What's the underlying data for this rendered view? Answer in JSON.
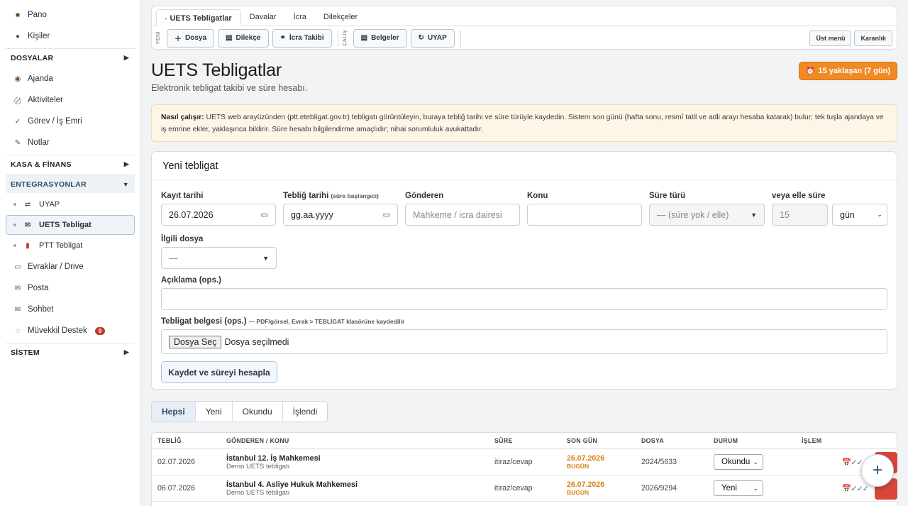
{
  "sidebar": {
    "top_items": [
      {
        "label": "Pano",
        "icon": "dashboard-icon"
      },
      {
        "label": "Kişiler",
        "icon": "people-icon"
      }
    ],
    "sections": [
      {
        "label": "DOSYALAR",
        "open": false
      },
      {
        "label": "KASA & FİNANS",
        "open": false
      },
      {
        "label": "ENTEGRASYONLAR",
        "open": true
      },
      {
        "label": "SİSTEM",
        "open": false
      }
    ],
    "dosyalar_items": [
      {
        "label": "Ajanda",
        "icon": "calendar-icon"
      },
      {
        "label": "Aktiviteler",
        "icon": "activity-icon"
      },
      {
        "label": "Görev / İş Emri",
        "icon": "check-icon"
      },
      {
        "label": "Notlar",
        "icon": "pencil-icon"
      }
    ],
    "integration_items": [
      {
        "label": "UYAP",
        "icon": "swap-icon"
      },
      {
        "label": "UETS Tebligat",
        "icon": "mail-icon",
        "active": true
      },
      {
        "label": "PTT Tebligat",
        "icon": "stamp-icon"
      },
      {
        "label": "Evraklar / Drive",
        "icon": "folder-icon"
      },
      {
        "label": "Posta",
        "icon": "envelope-icon"
      },
      {
        "label": "Sohbet",
        "icon": "chat-icon"
      },
      {
        "label": "Müvekkil Destek",
        "icon": "support-icon",
        "badge": "9"
      }
    ],
    "arrow_right": "▶",
    "arrow_down": "▼"
  },
  "topbar": {
    "tabs": [
      "UETS Tebligatlar",
      "Davalar",
      "İcra",
      "Dilekçeler"
    ],
    "yeni_label": "YENİ",
    "calis_label": "ÇALIŞ",
    "new_buttons": [
      {
        "label": "Dosya",
        "icon": "plus-icon"
      },
      {
        "label": "Dilekçe",
        "icon": "document-icon"
      },
      {
        "label": "İcra Takibi",
        "icon": "binoculars-icon"
      }
    ],
    "work_buttons": [
      {
        "label": "Belgeler",
        "icon": "document-icon"
      },
      {
        "label": "UYAP",
        "icon": "refresh-icon"
      }
    ],
    "right_buttons": [
      "Üst menü",
      "Karanlık"
    ]
  },
  "page": {
    "title": "UETS Tebligatlar",
    "subtitle": "Elektronik tebligat takibi ve süre hesabı.",
    "warning_pill": "15 yaklaşan (7 gün)"
  },
  "info": {
    "strong": "Nasıl çalışır:",
    "text": " UETS web arayüzünden (ptt.etebligat.gov.tr) tebligatı görüntüleyin, buraya tebliğ tarihi ve süre türüyle kaydedin. Sistem son günü (hafta sonu, resmî tatil ve adli arayı hesaba katarak) bulur; tek tuşla ajandaya ve iş emrine ekler, yaklaşınca bildirir. Süre hesabı bilgilendirme amaçlıdır; nihai sorumluluk avukattadır."
  },
  "form": {
    "title": "Yeni tebligat",
    "kayit_label": "Kayıt tarihi",
    "kayit_value": "26.07.2026",
    "teblig_label": "Tebliğ tarihi",
    "teblig_hint": "(süre başlangıcı)",
    "teblig_placeholder": "gg.aa.yyyy",
    "gonderen_label": "Gönderen",
    "gonderen_placeholder": "Mahkeme / icra dairesi",
    "konu_label": "Konu",
    "sure_turu_label": "Süre türü",
    "sure_turu_value": "— (süre yok / elle)",
    "elle_label": "veya elle süre",
    "elle_value": "15",
    "elle_unit": "gün",
    "ilgili_label": "İlgili dosya",
    "ilgili_value": "—",
    "aciklama_label": "Açıklama (ops.)",
    "belge_label": "Tebligat belgesi (ops.)",
    "belge_hint": "— PDF/görsel, Evrak > TEBLİGAT klasörüne kaydedilir",
    "file_button": "Dosya Seç",
    "file_status": "Dosya seçilmedi",
    "submit": "Kaydet ve süreyi hesapla"
  },
  "filters": [
    "Hepsi",
    "Yeni",
    "Okundu",
    "İşlendi"
  ],
  "table": {
    "headers": [
      "TEBLİĞ",
      "GÖNDEREN / KONU",
      "SÜRE",
      "SON GÜN",
      "DOSYA",
      "DURUM",
      "İŞLEM"
    ],
    "rows": [
      {
        "teblig": "02.07.2026",
        "gonderen": "İstanbul 12. İş Mahkemesi",
        "konu": "Demo UETS tebligatı",
        "sure": "itiraz/cevap",
        "son_gun": "26.07.2026",
        "son_gun_note": "BUGÜN",
        "dosya": "2024/5633",
        "durum": "Okundu"
      },
      {
        "teblig": "06.07.2026",
        "gonderen": "İstanbul 4. Asliye Hukuk Mahkemesi",
        "konu": "Demo UETS tebligatı",
        "sure": "itiraz/cevap",
        "son_gun": "26.07.2026",
        "son_gun_note": "BUGÜN",
        "dosya": "2026/9294",
        "durum": "Yeni"
      }
    ],
    "actions": "📅✓✓✓"
  },
  "fab": "+"
}
